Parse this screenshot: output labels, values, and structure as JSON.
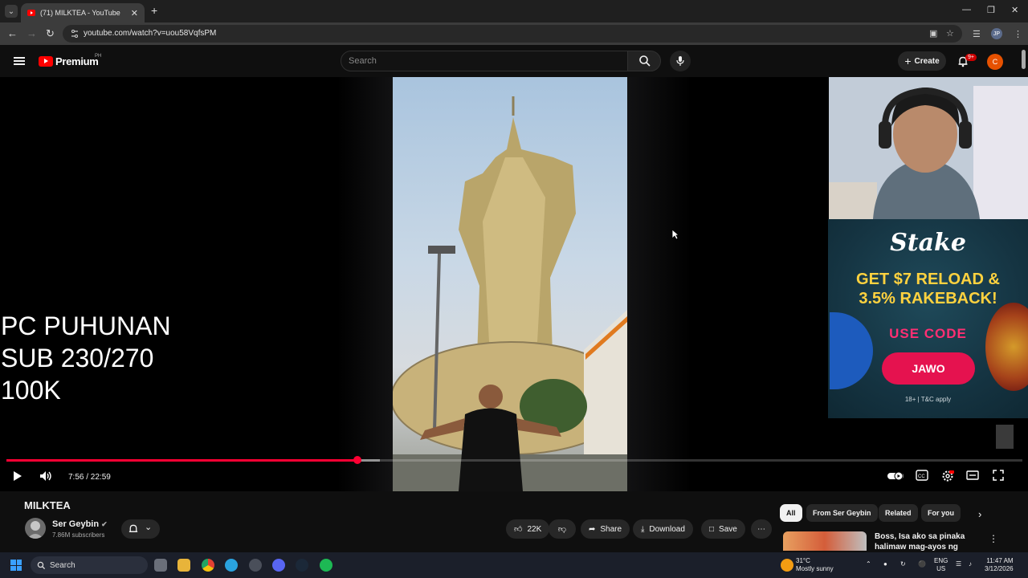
{
  "browser": {
    "tab_title": "(71) MILKTEA - YouTube",
    "url": "youtube.com/watch?v=uou58VqfsPM",
    "profile_initials": "JP"
  },
  "youtube_header": {
    "logo_text": "Premium",
    "region": "PH",
    "search_placeholder": "Search",
    "create_label": "Create",
    "notifications_badge": "9+",
    "avatar_letter": "C"
  },
  "player": {
    "overlay_lines": [
      "PC PUHUNAN",
      "SUB 230/270",
      "100K"
    ],
    "current_time": "7:56",
    "duration": "22:59",
    "time_display": "7:56 / 22:59",
    "progress_fraction": 0.3452
  },
  "ad": {
    "brand": "Stake",
    "headline_line1": "GET $7 RELOAD &",
    "headline_line2": "3.5% RAKEBACK!",
    "use_code_label": "USE CODE",
    "code": "JAWO",
    "disclaimer": "18+ | T&C apply"
  },
  "video": {
    "title": "MILKTEA",
    "channel_name": "Ser Geybin",
    "subscribers": "7.86M subscribers",
    "like_count": "22K",
    "share_label": "Share",
    "download_label": "Download",
    "save_label": "Save"
  },
  "chips": [
    "All",
    "From Ser Geybin",
    "Related",
    "For you"
  ],
  "recommendation": {
    "title": "Boss, Isa ako sa pinaka halimaw mag-ayos ng bibig"
  },
  "taskbar": {
    "search_label": "Search",
    "weather_temp": "31°C",
    "weather_desc": "Mostly sunny",
    "lang": "ENG",
    "region": "US",
    "time": "11:47 AM",
    "date": "3/12/2026"
  },
  "colors": {
    "progress": "#ff0033",
    "yt_red": "#ff0000",
    "ad_yellow": "#ffd23f",
    "ad_pink": "#e5124f"
  }
}
